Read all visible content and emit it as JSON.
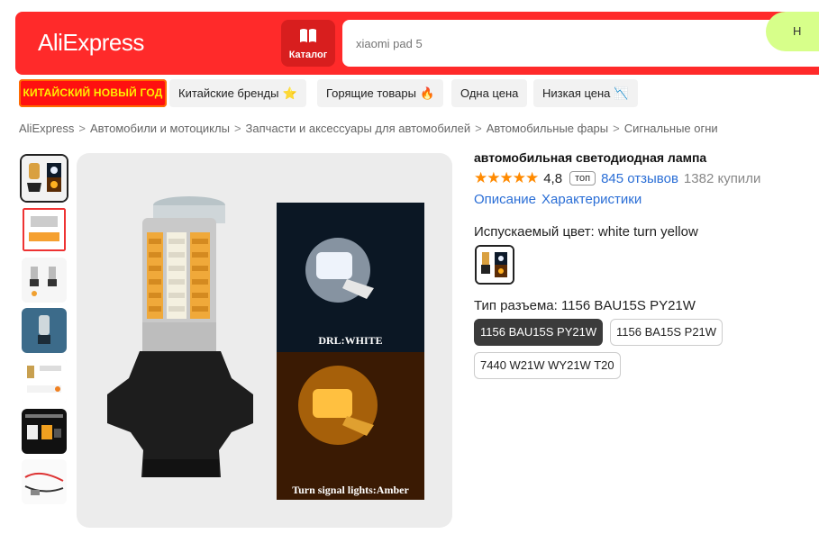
{
  "header": {
    "logo": "AliExpress",
    "catalog_label": "Каталог",
    "search_placeholder": "xiaomi pad 5",
    "search_button_label": "Н",
    "brand_color": "#ff2a2a"
  },
  "promo_chips": [
    {
      "label": "КИТАЙСКИЙ НОВЫЙ ГОД"
    },
    {
      "label": "Китайские бренды",
      "icon": "star-icon",
      "emoji": "⭐"
    },
    {
      "label": "Горящие товары",
      "icon": "fire-icon",
      "emoji": "🔥"
    },
    {
      "label": "Одна цена"
    },
    {
      "label": "Низкая цена",
      "icon": "trend-down-icon",
      "emoji": "📉"
    }
  ],
  "breadcrumb": [
    "AliExpress",
    "Автомобили и мотоциклы",
    "Запчасти и аксессуары для автомобилей",
    "Автомобильные фары",
    "Сигнальные огни"
  ],
  "product": {
    "title": "автомобильная светодиодная лампа",
    "stars": "★★★★★",
    "rating": "4,8",
    "top_badge": "топ",
    "reviews": "845 отзывов",
    "bought": "1382 купили",
    "tabs": [
      "Описание",
      "Характеристики"
    ],
    "image_text_top": "DRL:WHITE",
    "image_text_bottom": "Turn signal lights:Amber"
  },
  "color": {
    "label": "Испускаемый цвет: white turn yellow"
  },
  "connector": {
    "label": "Тип разъема: 1156 BAU15S PY21W",
    "options": [
      {
        "label": "1156 BAU15S PY21W",
        "selected": true
      },
      {
        "label": "1156 BA15S P21W",
        "selected": false
      },
      {
        "label": "7440 W21W WY21W T20",
        "selected": false
      }
    ]
  }
}
